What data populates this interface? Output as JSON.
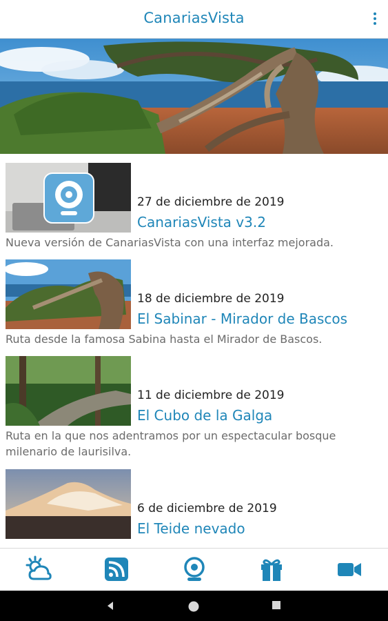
{
  "app": {
    "title": "CanariasVista"
  },
  "toolbar": {
    "menu_icon": "more-vert-icon"
  },
  "hero": {
    "image": "el-sabinar-tree-photo",
    "pages": 2,
    "active_page": 2
  },
  "news": [
    {
      "date": "27 de diciembre de 2019",
      "title": "CanariasVista v3.2",
      "description": "Nueva versión de CanariasVista con una interfaz mejorada.",
      "thumbnail": "webcam-app-laptop-photo"
    },
    {
      "date": "18 de diciembre de 2019",
      "title": "El Sabinar - Mirador de Bascos",
      "description": "Ruta desde la famosa Sabina hasta el Mirador de Bascos.",
      "thumbnail": "sabina-tree-photo"
    },
    {
      "date": "11 de diciembre de 2019",
      "title": "El Cubo de la Galga",
      "description": "Ruta en la que nos adentramos por un espectacular bosque milenario de laurisilva.",
      "thumbnail": "forest-path-photo"
    },
    {
      "date": "6 de diciembre de 2019",
      "title": "El Teide nevado",
      "description": "",
      "thumbnail": "teide-snow-photo"
    }
  ],
  "bottom_nav": [
    {
      "icon": "weather-icon",
      "active": false
    },
    {
      "icon": "rss-feed-icon",
      "active": true
    },
    {
      "icon": "webcam-icon",
      "active": false
    },
    {
      "icon": "gift-icon",
      "active": false
    },
    {
      "icon": "video-camera-icon",
      "active": false
    }
  ],
  "colors": {
    "accent": "#1f86b8",
    "text": "#222222",
    "muted": "#6b6b6b",
    "divider": "#d9d9d9"
  }
}
